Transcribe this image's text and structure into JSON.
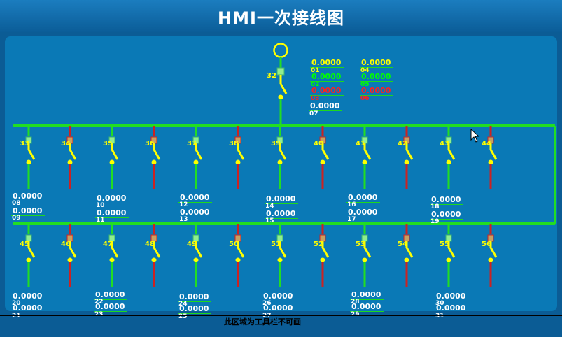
{
  "title": "HMI一次接线图",
  "toolbar_note": "此区域为工具栏不可画",
  "colors": {
    "bus": "#22dd22",
    "switch": "#ffff00",
    "open_line": "#cc2222",
    "breaker": "#90ee90"
  },
  "main_switch": {
    "number": "32"
  },
  "top_values": [
    {
      "value": "0.0000",
      "label": "01",
      "color": "#ffff00"
    },
    {
      "value": "0.0000",
      "label": "02",
      "color": "#00ff00"
    },
    {
      "value": "0.0000",
      "label": "03",
      "color": "#ff2020"
    },
    {
      "value": "0.0000",
      "label": "04",
      "color": "#ffff00"
    },
    {
      "value": "0.0000",
      "label": "05",
      "color": "#00ff00"
    },
    {
      "value": "0.0000",
      "label": "06",
      "color": "#ff2020"
    },
    {
      "value": "0.0000",
      "label": "07",
      "color": "#ffffff"
    }
  ],
  "row1_switches": [
    "33",
    "34",
    "35",
    "36",
    "37",
    "38",
    "39",
    "40",
    "41",
    "42",
    "43",
    "44"
  ],
  "row2_switches": [
    "45",
    "46",
    "47",
    "48",
    "49",
    "50",
    "51",
    "52",
    "53",
    "54",
    "55",
    "56"
  ],
  "row1_values": [
    {
      "value": "0.0000",
      "label": "08"
    },
    {
      "value": "0.0000",
      "label": "09"
    },
    {
      "value": "0.0000",
      "label": "10"
    },
    {
      "value": "0.0000",
      "label": "11"
    },
    {
      "value": "0.0000",
      "label": "12"
    },
    {
      "value": "0.0000",
      "label": "13"
    },
    {
      "value": "0.0000",
      "label": "14"
    },
    {
      "value": "0.0000",
      "label": "15"
    },
    {
      "value": "0.0000",
      "label": "16"
    },
    {
      "value": "0.0000",
      "label": "17"
    },
    {
      "value": "0.0000",
      "label": "18"
    },
    {
      "value": "0.0000",
      "label": "19"
    }
  ],
  "row2_values": [
    {
      "value": "0.0000",
      "label": "20"
    },
    {
      "value": "0.0000",
      "label": "21"
    },
    {
      "value": "0.0000",
      "label": "22"
    },
    {
      "value": "0.0000",
      "label": "23"
    },
    {
      "value": "0.0000",
      "label": "24"
    },
    {
      "value": "0.0000",
      "label": "25"
    },
    {
      "value": "0.0000",
      "label": "26"
    },
    {
      "value": "0.0000",
      "label": "27"
    },
    {
      "value": "0.0000",
      "label": "28"
    },
    {
      "value": "0.0000",
      "label": "29"
    },
    {
      "value": "0.0000",
      "label": "30"
    },
    {
      "value": "0.0000",
      "label": "31"
    }
  ]
}
